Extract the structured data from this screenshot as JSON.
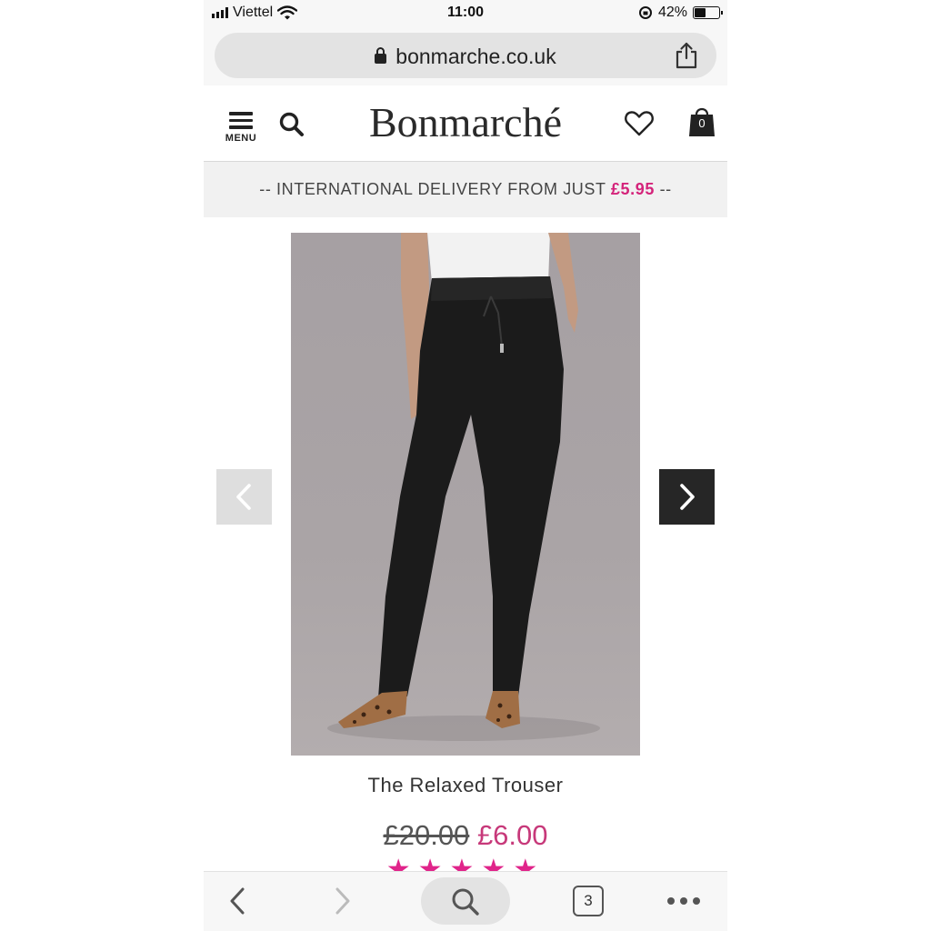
{
  "status_bar": {
    "carrier": "Viettel",
    "time": "11:00",
    "battery_percent": "42%",
    "battery_level": 0.42
  },
  "browser": {
    "url": "bonmarche.co.uk",
    "tab_count": "3"
  },
  "site": {
    "logo_text": "Bonmarché",
    "menu_label": "MENU",
    "bag_count": "0",
    "brand_accent": "#d4237a"
  },
  "promo": {
    "text": "-- INTERNATIONAL DELIVERY FROM JUST",
    "price": "£5.95",
    "suffix": "--"
  },
  "product": {
    "name": "The Relaxed Trouser",
    "old_price": "£20.00",
    "new_price": "£6.00",
    "stars": "★★★★★",
    "rating": 5
  },
  "icons": {
    "menu": "hamburger-icon",
    "search": "search-icon",
    "wishlist": "heart-icon",
    "bag": "shopping-bag-icon",
    "prev": "chevron-left-icon",
    "next": "chevron-right-icon",
    "share": "share-icon"
  }
}
